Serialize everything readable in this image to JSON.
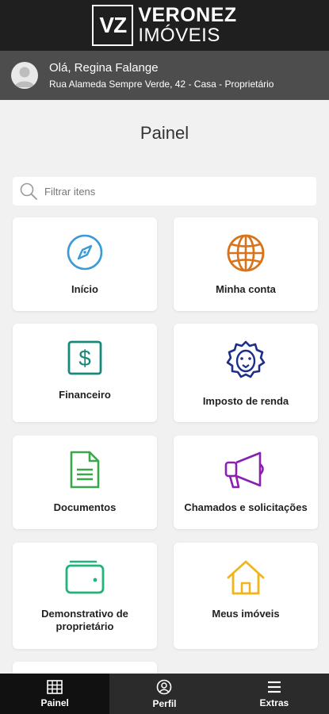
{
  "brand": {
    "mark": "VZ",
    "line1": "VERONEZ",
    "line2": "IMÓVEIS"
  },
  "user": {
    "greeting": "Olá, Regina Falange",
    "address": "Rua Alameda Sempre Verde, 42 - Casa - Proprietário"
  },
  "page_title": "Painel",
  "search": {
    "placeholder": "Filtrar itens"
  },
  "cards": [
    {
      "label": "Início",
      "icon": "compass-icon",
      "color": "#3a9ad9"
    },
    {
      "label": "Minha conta",
      "icon": "globe-icon",
      "color": "#d9731a"
    },
    {
      "label": "Financeiro",
      "icon": "dollar-icon",
      "color": "#17897a"
    },
    {
      "label": "Imposto de renda",
      "icon": "lion-icon",
      "color": "#1e2f8a"
    },
    {
      "label": "Documentos",
      "icon": "document-icon",
      "color": "#3aa84a"
    },
    {
      "label": "Chamados e solicitações",
      "icon": "megaphone-icon",
      "color": "#8a1fb0"
    },
    {
      "label": "Demonstrativo de proprietário",
      "icon": "wallet-icon",
      "color": "#22b37a"
    },
    {
      "label": "Meus imóveis",
      "icon": "house-icon",
      "color": "#f0b51a"
    }
  ],
  "nav": [
    {
      "label": "Painel",
      "icon": "grid-icon",
      "active": true
    },
    {
      "label": "Perfil",
      "icon": "user-circle-icon",
      "active": false
    },
    {
      "label": "Extras",
      "icon": "menu-icon",
      "active": false
    }
  ]
}
